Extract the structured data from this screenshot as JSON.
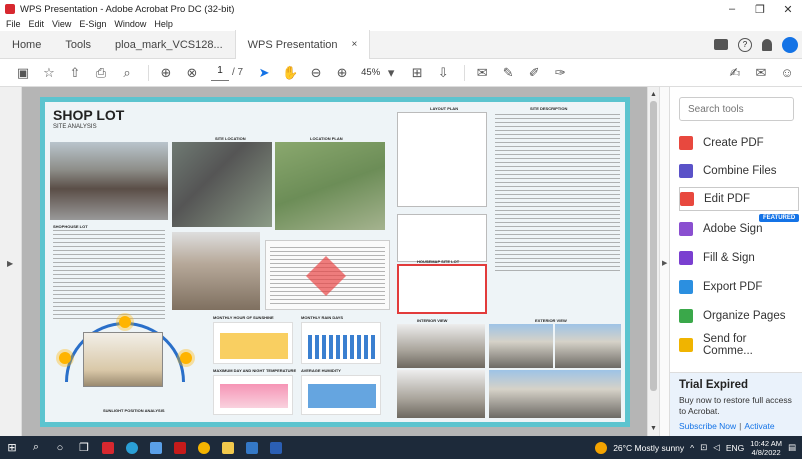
{
  "window": {
    "title": "WPS Presentation - Adobe Acrobat Pro DC (32-bit)",
    "minimize": "–",
    "maximize": "❐",
    "close": "✕"
  },
  "menu": [
    "File",
    "Edit",
    "View",
    "E-Sign",
    "Window",
    "Help"
  ],
  "tabs": {
    "home": "Home",
    "tools": "Tools",
    "doc1": "ploa_mark_VCS128...",
    "doc2": "WPS Presentation",
    "close": "×"
  },
  "toolbar": {
    "page_current": "1",
    "page_total": "/ 7",
    "zoom": "45%"
  },
  "poster": {
    "title": "SHOP LOT",
    "subtitle": "SITE ANALYSIS",
    "site_location": "SITE LOCATION",
    "location_plan": "LOCATION PLAN",
    "layout_plan": "LAYOUT PLAN",
    "site_description": "SITE DESCRIPTION",
    "housemap_site_lot": "HOUSEMAP SITE LOT",
    "interior_view": "INTERIOR VIEW",
    "exterior_view": "EXTERIOR VIEW",
    "monthly_hour_sunshine": "MONTHLY HOUR OF SUNSHINE",
    "monthly_rain_days": "MONTHLY RAIN DAYS",
    "max_day_night_temp": "MAXIMUM DAY AND NIGHT TEMPERATURE",
    "average_humidity": "AVERAGE HUMIDITY",
    "sunlight_position": "SUNLIGHT POSITION ANALYSIS",
    "shophouse_lot": "SHOPHOUSE LOT"
  },
  "tools_pane": {
    "search_placeholder": "Search tools",
    "items": [
      {
        "label": "Create PDF",
        "color": "#e8483e"
      },
      {
        "label": "Combine Files",
        "color": "#5a52c8"
      },
      {
        "label": "Edit PDF",
        "color": "#e8483e"
      },
      {
        "label": "Adobe Sign",
        "color": "#8a4fd0"
      },
      {
        "label": "Fill & Sign",
        "color": "#7a3fd0"
      },
      {
        "label": "Export PDF",
        "color": "#2b8fe0"
      },
      {
        "label": "Organize Pages",
        "color": "#3aa84a"
      },
      {
        "label": "Send for Comme...",
        "color": "#f0b400"
      }
    ],
    "featured_badge": "FEATURED",
    "trial_title": "Trial Expired",
    "trial_desc": "Buy now to restore full access to Acrobat.",
    "subscribe": "Subscribe Now",
    "activate": "Activate"
  },
  "taskbar": {
    "weather": "26°C  Mostly sunny",
    "lang": "ENG",
    "time": "10:42 AM",
    "date": "4/8/2022"
  }
}
